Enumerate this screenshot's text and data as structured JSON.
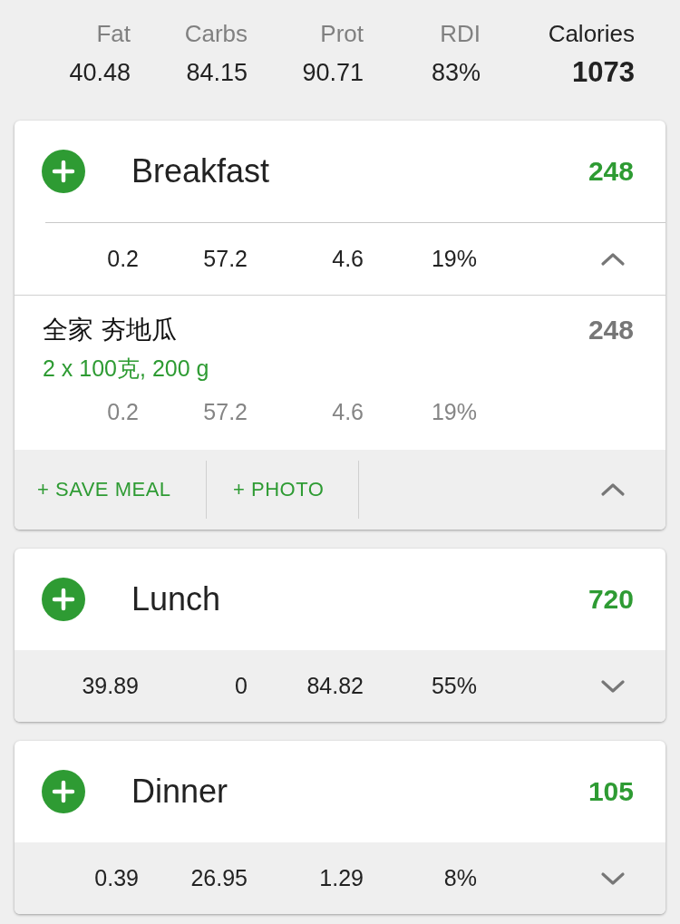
{
  "summary": {
    "columns": [
      {
        "label": "Fat",
        "value": "40.48",
        "kind": "macro"
      },
      {
        "label": "Carbs",
        "value": "84.15",
        "kind": "macro"
      },
      {
        "label": "Prot",
        "value": "90.71",
        "kind": "macro"
      },
      {
        "label": "RDI",
        "value": "83%",
        "kind": "macro"
      },
      {
        "label": "Calories",
        "value": "1073",
        "kind": "total"
      }
    ]
  },
  "meals": [
    {
      "name": "Breakfast",
      "calories": "248",
      "expanded": true,
      "totals": [
        "0.2",
        "57.2",
        "4.6",
        "19%"
      ],
      "items": [
        {
          "name": "全家 夯地瓜",
          "serving": "2 x 100克, 200 g",
          "calories": "248",
          "values": [
            "0.2",
            "57.2",
            "4.6",
            "19%"
          ]
        }
      ],
      "actions": [
        "+ SAVE MEAL",
        "+ PHOTO"
      ]
    },
    {
      "name": "Lunch",
      "calories": "720",
      "expanded": false,
      "totals": [
        "39.89",
        "0",
        "84.82",
        "55%"
      ]
    },
    {
      "name": "Dinner",
      "calories": "105",
      "expanded": false,
      "totals": [
        "0.39",
        "26.95",
        "1.29",
        "8%"
      ]
    }
  ]
}
